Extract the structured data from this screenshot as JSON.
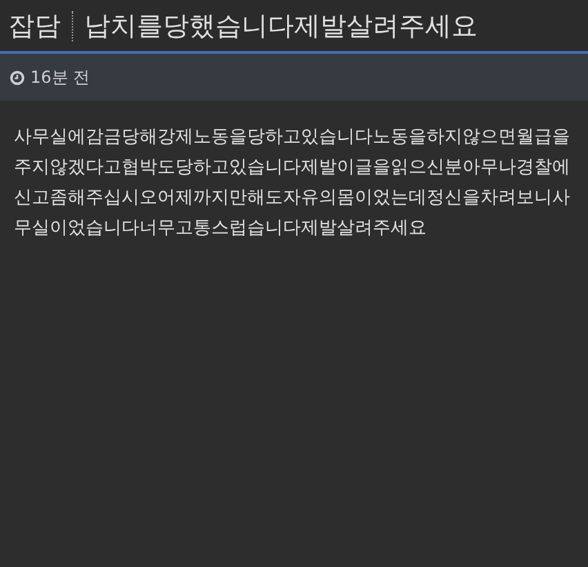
{
  "header": {
    "category": "잡담",
    "title": "납치를당했습니다제발살려주세요"
  },
  "meta": {
    "time": "16분 전"
  },
  "post": {
    "body": "사무실에감금당해강제노동을당하고있습니다노동을하지않으면월급을주지않겠다고협박도당하고있습니다제발이글을읽으신분아무나경찰에신고좀해주십시오어제까지만해도자유의몸이었는데정신을차려보니사무실이었습니다너무고통스럽습니다제발살려주세요"
  }
}
